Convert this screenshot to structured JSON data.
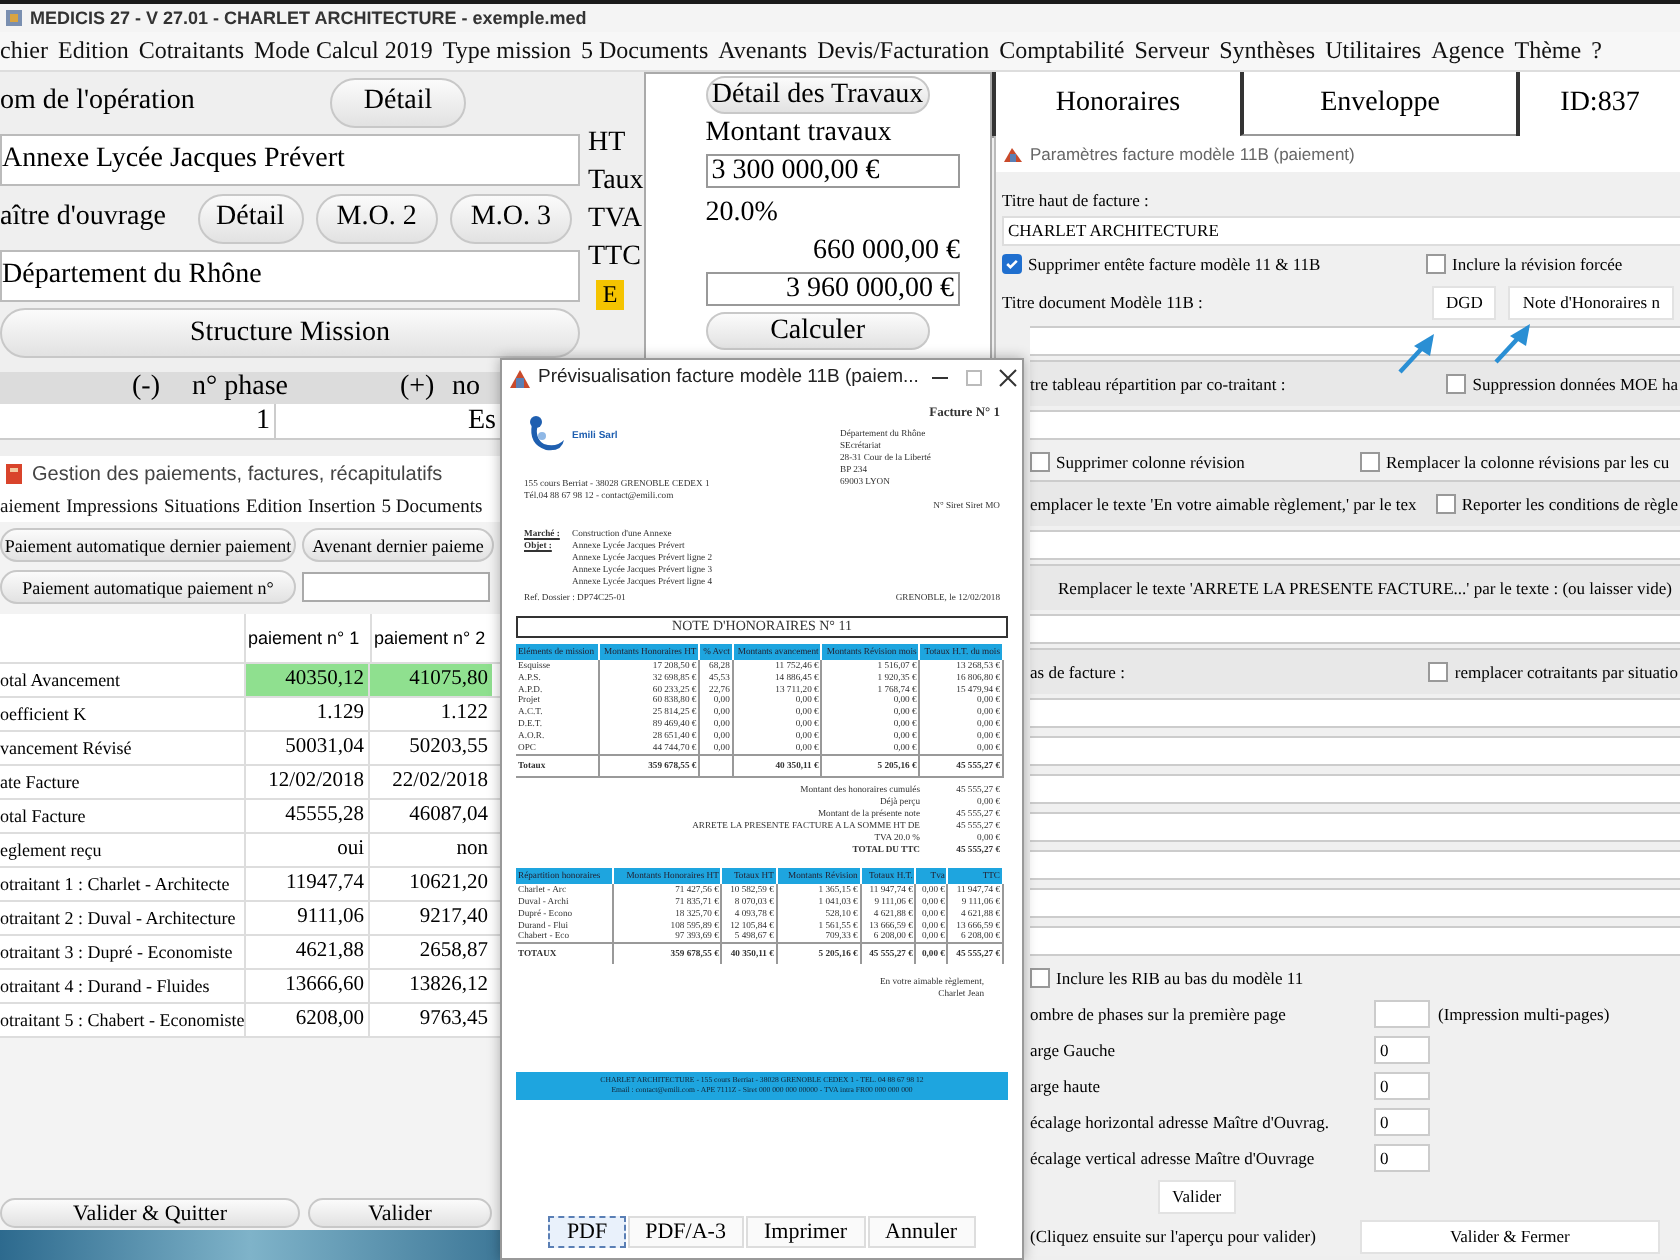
{
  "app": {
    "title": "MEDICIS 27  - V 27.01 - CHARLET ARCHITECTURE - exemple.med",
    "menu": [
      "chier",
      "Edition",
      "Cotraitants",
      "Mode Calcul 2019",
      "Type mission",
      "5 Documents",
      "Avenants",
      "Devis/Facturation",
      "Comptabilité",
      "Serveur",
      "Synthèses",
      "Utilitaires",
      "Agence",
      "Thème",
      "?"
    ]
  },
  "operation": {
    "name_label": "om de l'opération",
    "name_button": "Détail",
    "name_value": "Annexe Lycée Jacques Prévert",
    "owner_label": "aître d'ouvrage",
    "owner_buttons": [
      "Détail",
      "M.O. 2",
      "M.O. 3"
    ],
    "owner_value": "Département du Rhône",
    "structure_button": "Structure Mission"
  },
  "amount_labels": [
    "HT",
    "Taux",
    "TVA",
    "TTC"
  ],
  "e_badge": "E",
  "works": {
    "detail_button": "Détail des Travaux",
    "label": "Montant travaux",
    "ht_value": "3 300 000,00 €",
    "rate": "20.0%",
    "tva": "660 000,00 €",
    "ttc_value": "3 960 000,00 €",
    "calc_button": "Calculer"
  },
  "main_tabs": [
    "Honoraires",
    "Enveloppe",
    "ID:837"
  ],
  "phase_table": {
    "headers": [
      "(-)",
      "n° phase",
      "(+)",
      "no"
    ],
    "rows": [
      [
        "1",
        "Es"
      ]
    ]
  },
  "payments": {
    "title": "Gestion des paiements, factures, récapitulatifs",
    "menu": [
      "aiement",
      "Impressions",
      "Situations",
      "Edition",
      "Insertion",
      "5 Documents"
    ],
    "auto_last_button": "Paiement automatique dernier paiement",
    "amendment_button": "Avenant dernier paieme",
    "auto_n_button": "Paiement automatique paiement n°",
    "columns": [
      "paiement n° 1",
      "paiement n° 2"
    ],
    "rows": [
      {
        "label": "otal Avancement",
        "values": [
          "40350,12",
          "41075,80"
        ],
        "highlighted": true
      },
      {
        "label": "oefficient K",
        "values": [
          "1.129",
          "1.122"
        ],
        "highlighted": false
      },
      {
        "label": "vancement Révisé",
        "values": [
          "50031,04",
          "50203,55"
        ],
        "highlighted": false
      },
      {
        "label": "ate Facture",
        "values": [
          "12/02/2018",
          "22/02/2018"
        ],
        "highlighted": false
      },
      {
        "label": "otal Facture",
        "values": [
          "45555,28",
          "46087,04"
        ],
        "highlighted": false
      },
      {
        "label": "eglement reçu",
        "values": [
          "oui",
          "non"
        ],
        "highlighted": false
      },
      {
        "label": "otraitant 1 : Charlet - Architecte",
        "values": [
          "11947,74",
          "10621,20"
        ],
        "highlighted": false
      },
      {
        "label": "otraitant 2 : Duval - Architecture",
        "values": [
          "9111,06",
          "9217,40"
        ],
        "highlighted": false
      },
      {
        "label": "otraitant 3 : Dupré - Economiste",
        "values": [
          "4621,88",
          "2658,87"
        ],
        "highlighted": false
      },
      {
        "label": "otraitant 4 : Durand - Fluides",
        "values": [
          "13666,60",
          "13826,12"
        ],
        "highlighted": false
      },
      {
        "label": "otraitant 5 : Chabert - Economiste",
        "values": [
          "6208,00",
          "9763,45"
        ],
        "highlighted": false
      }
    ],
    "buttons": [
      "Valider & Quitter",
      "Valider"
    ]
  },
  "preview": {
    "title": "Prévisualisation facture modèle 11B (paiem...",
    "company": "Emili Sarl",
    "company_lines": [
      "155 cours Berriat - 38028 GRENOBLE CEDEX 1",
      "Tél.04 88 67 98 12 - contact@emili.com"
    ],
    "invoice_title": "Facture N° 1",
    "client_lines": [
      "Département du Rhône",
      "SEcrétariat",
      "28-31 Cour de la Liberté",
      "BP 234",
      "69003 LYON"
    ],
    "siret": "N° Siret Siret MO",
    "subject": [
      {
        "label": "Marché :",
        "lines": [
          "Construction d'une Annexe"
        ]
      },
      {
        "label": "Objet :",
        "lines": [
          "Annexe Lycée Jacques Prévert",
          "Annexe Lycée Jacques Prévert ligne 2",
          "Annexe Lycée Jacques Prévert ligne 3",
          "Annexe Lycée Jacques Prévert ligne 4"
        ]
      }
    ],
    "ref": "Ref. Dossier : DP74C25-01",
    "place_date": "GRENOBLE, le 12/02/2018",
    "note_title": "NOTE D'HONORAIRES N° 11",
    "mission_table": {
      "headers": [
        "Eléments de mission",
        "Montants Honoraires HT",
        "% Avct",
        "Montants avancement",
        "Montants Révision mois",
        "Totaux H.T. du mois"
      ],
      "rows": [
        [
          "Esquisse",
          "17 208,50 €",
          "68,28",
          "11 752,46 €",
          "1 516,07 €",
          "13 268,53 €"
        ],
        [
          "A.P.S.",
          "32 698,85 €",
          "45,53",
          "14 886,45 €",
          "1 920,35 €",
          "16 806,80 €"
        ],
        [
          "A.P.D.",
          "60 233,25 €",
          "22,76",
          "13 711,20 €",
          "1 768,74 €",
          "15 479,94 €"
        ],
        [
          "Projet",
          "60 838,80 €",
          "0,00",
          "0,00 €",
          "0,00 €",
          "0,00 €"
        ],
        [
          "A.C.T.",
          "25 814,25 €",
          "0,00",
          "0,00 €",
          "0,00 €",
          "0,00 €"
        ],
        [
          "D.E.T.",
          "89 469,40 €",
          "0,00",
          "0,00 €",
          "0,00 €",
          "0,00 €"
        ],
        [
          "A.O.R.",
          "28 651,40 €",
          "0,00",
          "0,00 €",
          "0,00 €",
          "0,00 €"
        ],
        [
          "OPC",
          "44 744,70 €",
          "0,00",
          "0,00 €",
          "0,00 €",
          "0,00 €"
        ]
      ],
      "totals": {
        "label": "Totaux",
        "fees": "359 678,55 €",
        "progress": "40 350,11 €",
        "revision": "5 205,16 €",
        "month_total": "45 555,27 €"
      }
    },
    "summary": [
      {
        "label": "Montant des honoraires cumulés",
        "value": "45 555,27 €",
        "bold": false
      },
      {
        "label": "Déjà perçu",
        "value": "0,00 €",
        "bold": false
      },
      {
        "label": "Montant de la présente note",
        "value": "45 555,27 €",
        "bold": false
      },
      {
        "label": "ARRETE LA PRESENTE FACTURE A LA SOMME HT DE",
        "value": "45 555,27 €",
        "bold": false
      },
      {
        "label": "TVA 20.0 %",
        "value": "0,00 €",
        "bold": false
      },
      {
        "label": "TOTAL DU TTC",
        "value": "45 555,27 €",
        "bold": true
      }
    ],
    "split_table": {
      "headers": [
        "Répartition honoraires",
        "Montants Honoraires HT",
        "Totaux HT",
        "Montants Révision",
        "Totaux H.T.",
        "Tva",
        "TTC"
      ],
      "rows": [
        [
          "Charlet - Arc",
          "71 427,56 €",
          "10 582,59 €",
          "1 365,15 €",
          "11 947,74 €",
          "0,00 €",
          "11 947,74 €"
        ],
        [
          "Duval - Archi",
          "71 835,71 €",
          "8 070,03 €",
          "1 041,03 €",
          "9 111,06 €",
          "0,00 €",
          "9 111,06 €"
        ],
        [
          "Dupré - Econo",
          "18 325,70 €",
          "4 093,78 €",
          "528,10 €",
          "4 621,88 €",
          "0,00 €",
          "4 621,88 €"
        ],
        [
          "Durand - Flui",
          "108 595,89 €",
          "12 105,84 €",
          "1 561,55 €",
          "13 666,59 €",
          "0,00 €",
          "13 666,59 €"
        ],
        [
          "Chabert - Eco",
          "97 393,69 €",
          "5 498,67 €",
          "709,33 €",
          "6 208,00 €",
          "0,00 €",
          "6 208,00 €"
        ]
      ],
      "totals": [
        "TOTAUX",
        "359 678,55 €",
        "40 350,11 €",
        "5 205,16 €",
        "45 555,27 €",
        "0,00 €",
        "45 555,27 €"
      ]
    },
    "closing": [
      "En votre aimable règlement,",
      "Charlet Jean"
    ],
    "footer": [
      "CHARLET ARCHITECTURE - 155 cours Berriat - 38028 GRENOBLE CEDEX 1 - TEL. 04 88 67 98 12",
      "Email : contact@emili.com - APE 7111Z - Siret 000 000 000 00000 - TVA intra FR00 000 000 000"
    ],
    "buttons": [
      {
        "label": "PDF",
        "selected": true
      },
      {
        "label": "PDF/A-3",
        "selected": false
      },
      {
        "label": "Imprimer",
        "selected": false
      },
      {
        "label": "Annuler",
        "selected": false
      }
    ]
  },
  "params": {
    "title": "Paramètres facture modèle 11B (paiement)",
    "header_label": "Titre haut de facture :",
    "header_value": "CHARLET ARCHITECTURE",
    "rows": [
      {
        "kind": "checks",
        "checks": [
          {
            "label": "Supprimer entête facture modèle 11 & 11B",
            "checked": true
          },
          {
            "label": "Inclure la révision forcée",
            "checked": false
          }
        ]
      },
      {
        "kind": "buttons",
        "label": "Titre document Modèle 11B :",
        "buttons": [
          "DGD",
          "Note d'Honoraires n"
        ]
      },
      {
        "kind": "field"
      },
      {
        "kind": "label_check",
        "label": "tre tableau répartition par co-traitant :",
        "check": {
          "label": "Suppression données MOE ha",
          "checked": false
        }
      },
      {
        "kind": "field"
      },
      {
        "kind": "checks",
        "checks": [
          {
            "label": "Supprimer colonne révision",
            "checked": false
          },
          {
            "label": "Remplacer la colonne révisions par les cu",
            "checked": false
          }
        ]
      },
      {
        "kind": "label_check",
        "label": "emplacer le texte 'En votre aimable règlement,' par le tex",
        "check": {
          "label": "Reporter les conditions de règle",
          "checked": false
        }
      },
      {
        "kind": "field"
      },
      {
        "kind": "banner",
        "label": "Remplacer le texte 'ARRETE LA PRESENTE FACTURE...' par le texte :   (ou laisser vide)"
      },
      {
        "kind": "field"
      },
      {
        "kind": "label_check",
        "label": "as de facture :",
        "check": {
          "label": "remplacer cotraitants par situatio",
          "checked": false
        }
      },
      {
        "kind": "field"
      },
      {
        "kind": "field"
      },
      {
        "kind": "field"
      },
      {
        "kind": "field"
      },
      {
        "kind": "field"
      },
      {
        "kind": "field"
      },
      {
        "kind": "field"
      },
      {
        "kind": "checks",
        "checks": [
          {
            "label": "Inclure les RIB au bas du modèle 11",
            "checked": false
          }
        ]
      }
    ],
    "settings": [
      {
        "label": "ombre de phases sur la première page",
        "note": "(Impression multi-pages)"
      },
      {
        "label": "arge Gauche",
        "value": "0"
      },
      {
        "label": "arge haute",
        "value": "0"
      },
      {
        "label": "écalage horizontal adresse Maître d'Ouvrag.",
        "value": "0"
      },
      {
        "label": "écalage vertical adresse Maître d'Ouvrage",
        "value": "0"
      }
    ],
    "validate_button": "Valider",
    "hint": "(Cliquez ensuite sur l'aperçu pour valider)",
    "close_button": "Valider & Fermer"
  }
}
